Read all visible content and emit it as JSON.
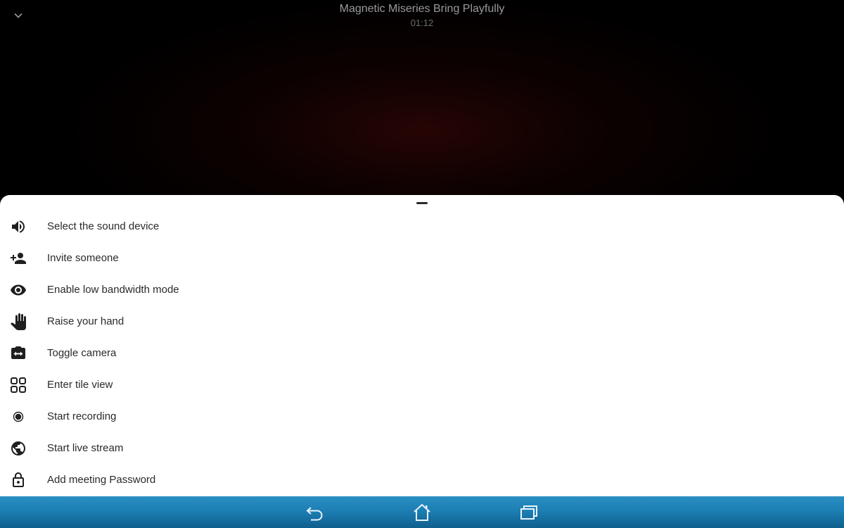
{
  "meeting": {
    "title": "Magnetic Miseries Bring Playfully",
    "timer": "01:12"
  },
  "icons": {
    "collapse": "chevron-down-icon",
    "sheet_handle": "drag-handle-icon"
  },
  "menu": {
    "items": [
      {
        "label": "Select the sound device",
        "icon": "speaker-icon"
      },
      {
        "label": "Invite someone",
        "icon": "add-person-icon"
      },
      {
        "label": "Enable low bandwidth mode",
        "icon": "eye-icon"
      },
      {
        "label": "Raise your hand",
        "icon": "hand-icon"
      },
      {
        "label": "Toggle camera",
        "icon": "switch-camera-icon"
      },
      {
        "label": "Enter tile view",
        "icon": "tile-grid-icon"
      },
      {
        "label": "Start recording",
        "icon": "record-icon"
      },
      {
        "label": "Start live stream",
        "icon": "globe-icon"
      },
      {
        "label": "Add meeting Password",
        "icon": "lock-icon"
      }
    ]
  },
  "navbar": {
    "back": "back-icon",
    "home": "home-icon",
    "recents": "recent-apps-icon"
  },
  "colors": {
    "sheet_background": "#ffffff",
    "navbar": "#1d7fb4",
    "call_background": "#000000"
  }
}
